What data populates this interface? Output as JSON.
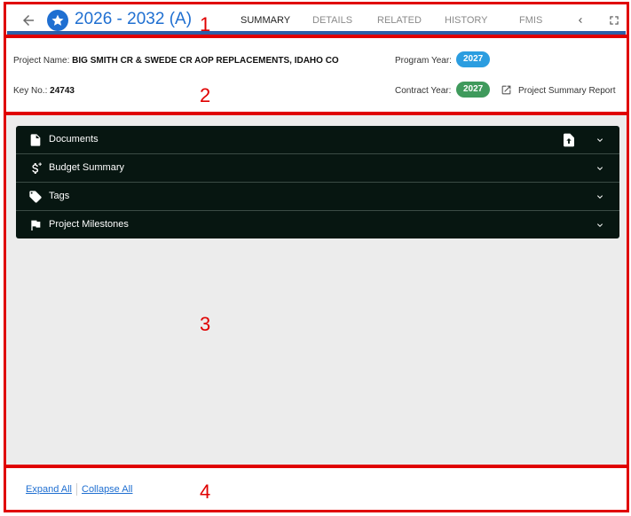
{
  "header": {
    "title": "2026 - 2032 (A)",
    "tabs": [
      {
        "label": "SUMMARY",
        "active": true
      },
      {
        "label": "DETAILS",
        "active": false
      },
      {
        "label": "RELATED",
        "active": false
      },
      {
        "label": "HISTORY",
        "active": false
      },
      {
        "label": "FMIS",
        "active": false
      }
    ],
    "icons": [
      "back-arrow-icon",
      "star-icon",
      "chevron-left-icon",
      "fullscreen-icon"
    ]
  },
  "details": {
    "project_name_label": "Project Name:",
    "project_name_value": "BIG SMITH CR & SWEDE CR AOP REPLACEMENTS, IDAHO CO",
    "key_no_label": "Key No.:",
    "key_no_value": "24743",
    "program_year_label": "Program Year:",
    "program_year_value": "2027",
    "contract_year_label": "Contract Year:",
    "contract_year_value": "2027",
    "report_link": "Project Summary Report",
    "colors": {
      "program_year_pill": "#2b9de0",
      "contract_year_pill": "#3f9a5c"
    }
  },
  "accordion": {
    "items": [
      {
        "label": "Documents",
        "icon": "document-icon"
      },
      {
        "label": "Budget Summary",
        "icon": "dollar-icon"
      },
      {
        "label": "Tags",
        "icon": "tag-icon"
      },
      {
        "label": "Project Milestones",
        "icon": "flag-icon"
      }
    ],
    "colors": {
      "background": "#071611"
    }
  },
  "footer": {
    "expand_all": "Expand All",
    "collapse_all": "Collapse All"
  },
  "region_numbers": [
    "1",
    "2",
    "3",
    "4"
  ]
}
